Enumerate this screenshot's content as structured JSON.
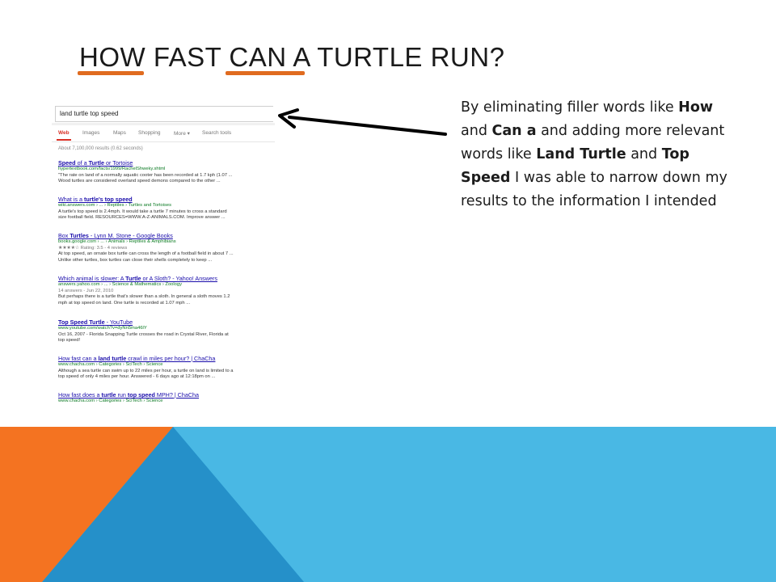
{
  "slide": {
    "title": "HOW FAST CAN A TURTLE RUN?",
    "accent_color": "#e06b1f",
    "description": {
      "p1": "By eliminating filler words like ",
      "b1": "How",
      "p2": " and ",
      "b2": "Can a",
      "p3": " and adding more relevant words like ",
      "b3": "Land Turtle",
      "p4": " and ",
      "b4": "Top Speed",
      "p5": " I was able to narrow down my results to the information I intended"
    },
    "colors": {
      "blue": "#37aee0",
      "orange": "#f47321",
      "dark_blue": "#2590c9",
      "light_blue": "#49b8e4"
    }
  },
  "search": {
    "query": "land turtle top speed",
    "tabs": {
      "web": "Web",
      "images": "Images",
      "maps": "Maps",
      "shopping": "Shopping",
      "more": "More ▾",
      "tools": "Search tools"
    },
    "result_count": "About 7,100,000 results (0.62 seconds)",
    "results": [
      {
        "title_pre": "",
        "title_hl": "Speed",
        "title_mid": " of a ",
        "title_hl2": "Turtle",
        "title_post": " or Tortoise",
        "url": "hypertextbook.com/facts/1999/RachelShweky.shtml",
        "meta": "",
        "lines": [
          "\"The rate on land of a normally aquatic cooter has been recorded at 1.7 kph (1.07 ...",
          "Wood turtles are considered overland speed demons compared to the other ..."
        ]
      },
      {
        "title_pre": "What is a ",
        "title_hl": "turtle's top speed",
        "title_mid": "",
        "title_hl2": "",
        "title_post": "",
        "url": "wiki.answers.com › ... › Reptiles › Turtles and Tortoises",
        "meta": "",
        "lines": [
          "A turtle's top speed is 2.4mph. It would take a turtle 7 minutes to cross a standard",
          "size football field. RESOURCES=WWW.A-Z-ANIMALS.COM. Improve answer ..."
        ]
      },
      {
        "title_pre": "Box ",
        "title_hl": "Turtles",
        "title_mid": " - Lynn M. Stone - Google Books",
        "title_hl2": "",
        "title_post": "",
        "url": "books.google.com › ... › Animals › Reptiles & Amphibians",
        "meta": "★★★★☆ Rating: 3.5 - 4 reviews",
        "lines": [
          "At top speed, an ornate box turtle can cross the length of a football field in about 7 ...",
          "Unlike other turtles, box turtles can close their shells completely to keep ..."
        ]
      },
      {
        "title_pre": "Which animal is slower: A ",
        "title_hl": "Turtle",
        "title_mid": " or A Sloth? - Yahoo! Answers",
        "title_hl2": "",
        "title_post": "",
        "url": "answers.yahoo.com › ... › Science & Mathematics › Zoology",
        "meta": "14 answers - Jun 22, 2010",
        "lines": [
          "But perhaps there is a turtle that's slower than a sloth. In general a sloth moves 1.2",
          "mph at top speed on land. One turtle is recorded at 1.07 mph ..."
        ]
      },
      {
        "title_pre": "",
        "title_hl": "Top Speed Turtle",
        "title_mid": " - YouTube",
        "title_hl2": "",
        "title_post": "",
        "url": "www.youtube.com/watch?v=dyNn5ma46lY",
        "meta": "",
        "lines": [
          "Oct 16, 2007 - Florida Snapping Turtle crosses the road in Crystal River, Florida at",
          "top speed!"
        ]
      },
      {
        "title_pre": "How fast can a ",
        "title_hl": "land turtle",
        "title_mid": " crawl in miles per hour? | ChaCha",
        "title_hl2": "",
        "title_post": "",
        "url": "www.chacha.com › Categories › SciTech › Science",
        "meta": "",
        "lines": [
          "Although a sea turtle can swim up to 22 miles per hour, a turtle on land is limited to a",
          "top speed of only 4 miles per hour. Answered - 6 days ago at 12:18pm on ..."
        ]
      },
      {
        "title_pre": "How fast does a ",
        "title_hl": "turtle",
        "title_mid": " run ",
        "title_hl2": "top speed",
        "title_post": " MPH? | ChaCha",
        "url": "www.chacha.com › Categories › SciTech › Science",
        "meta": "",
        "lines": []
      }
    ]
  }
}
